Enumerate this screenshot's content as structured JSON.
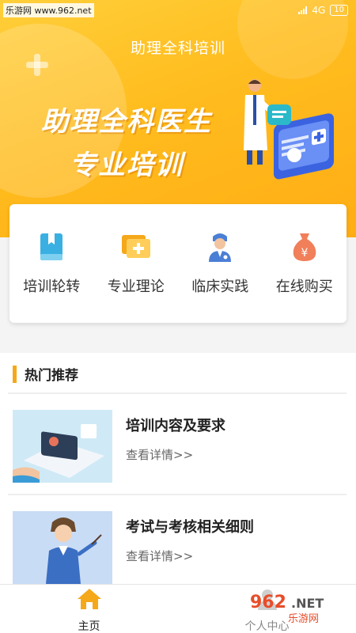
{
  "watermark": "乐游网 www.962.net",
  "status": {
    "network": "4G",
    "battery": "10"
  },
  "header": {
    "title": "助理全科培训"
  },
  "banner": {
    "line1": "助理全科医生",
    "line2": "专业培训"
  },
  "menu": [
    {
      "label": "培训轮转",
      "icon": "book-icon",
      "color": "#3ab0e2"
    },
    {
      "label": "专业理论",
      "icon": "chat-plus-icon",
      "color": "#f5a81a"
    },
    {
      "label": "临床实践",
      "icon": "doctor-icon",
      "color": "#4a7fd6"
    },
    {
      "label": "在线购买",
      "icon": "money-bag-icon",
      "color": "#f07f5a"
    }
  ],
  "section": {
    "title": "热门推荐"
  },
  "articles": [
    {
      "title": "培训内容及要求",
      "more": "查看详情>>"
    },
    {
      "title": "考试与考核相关细则",
      "more": "查看详情>>"
    }
  ],
  "tabs": [
    {
      "label": "主页",
      "icon": "home-icon"
    },
    {
      "label": "个人中心",
      "icon": "user-icon"
    }
  ],
  "colors": {
    "accent": "#f5a81a",
    "hero": "#ffbc1e"
  },
  "logo_text": "962.NET 乐游网"
}
